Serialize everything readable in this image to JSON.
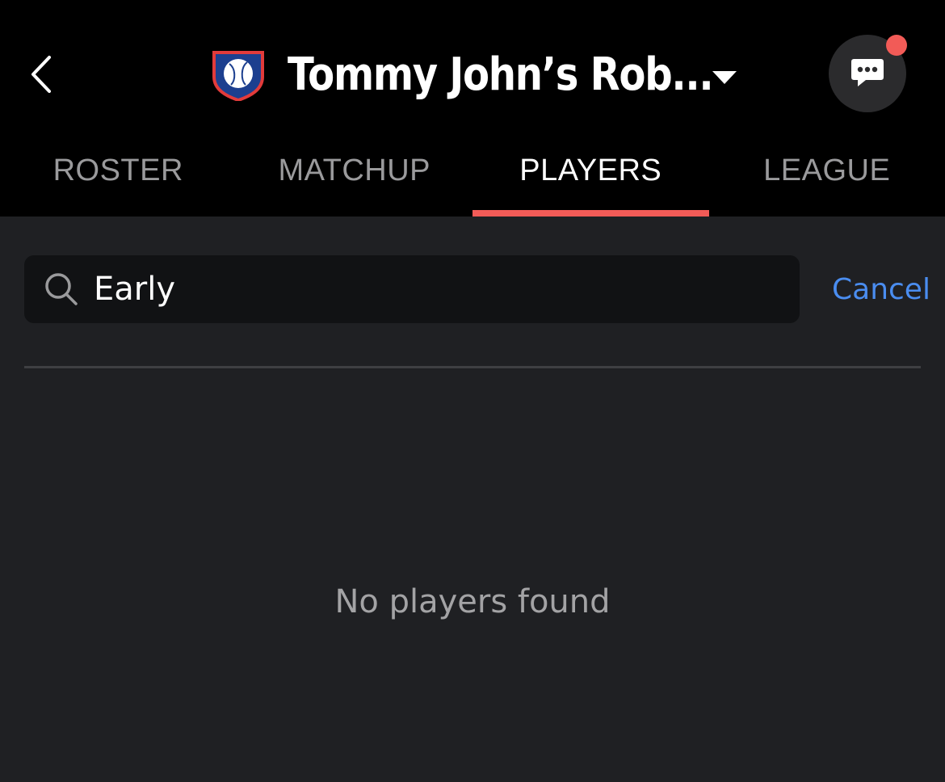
{
  "header": {
    "team_name": "Tommy John’s Rob...",
    "back_icon": "chevron-left-icon",
    "caret_icon": "caret-down-icon",
    "chat_icon": "chat-bubble-icon",
    "logo_icon": "baseball-shield-icon",
    "notification_color": "#f25b57"
  },
  "tabs": [
    {
      "label": "ROSTER",
      "active": false
    },
    {
      "label": "MATCHUP",
      "active": false
    },
    {
      "label": "PLAYERS",
      "active": true
    },
    {
      "label": "LEAGUE",
      "active": false
    }
  ],
  "search": {
    "value": "Early",
    "icon": "search-icon",
    "cancel_label": "Cancel"
  },
  "results": {
    "empty_message": "No players found"
  },
  "colors": {
    "accent": "#f25b57",
    "link": "#4a8df0",
    "background": "#1f2023",
    "header_background": "#000000"
  }
}
